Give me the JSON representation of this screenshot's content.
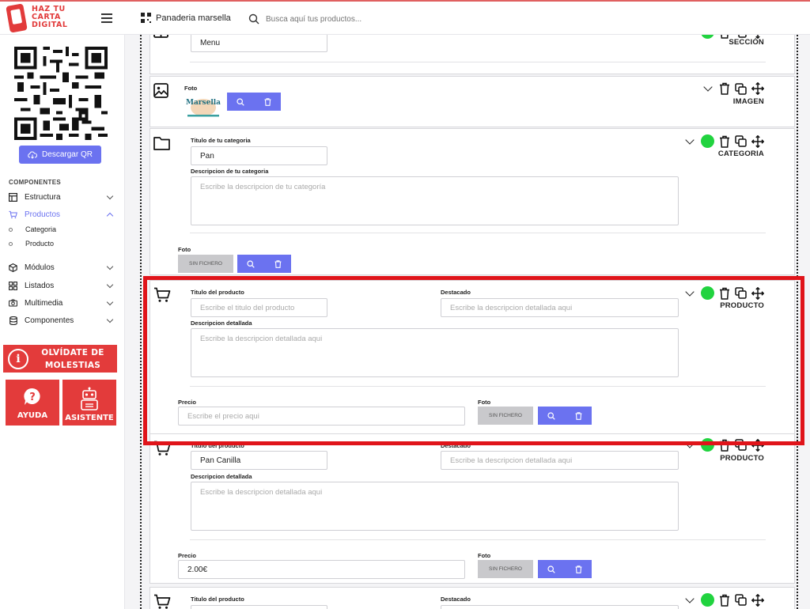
{
  "brand": {
    "logo_text_1": "HAZ TU",
    "logo_text_2": "CARTA",
    "logo_text_3": "DIGITAL"
  },
  "header": {
    "store_name": "Panaderia marsella",
    "search_placeholder": "Busca aquí tus productos..."
  },
  "sidebar": {
    "download_qr": "Descargar QR",
    "section_label": "COMPONENTES",
    "items": [
      {
        "label": "Estructura",
        "icon": "layout-icon"
      },
      {
        "label": "Productos",
        "icon": "cart-icon"
      },
      {
        "label": "Categoria",
        "icon": "circle-icon"
      },
      {
        "label": "Producto",
        "icon": "circle-icon"
      },
      {
        "label": "Módulos",
        "icon": "box-icon"
      },
      {
        "label": "Listados",
        "icon": "grid-icon"
      },
      {
        "label": "Multimedia",
        "icon": "camera-icon"
      },
      {
        "label": "Componentes",
        "icon": "database-icon"
      }
    ],
    "banner_molestias_1": "OLVÍDATE DE",
    "banner_molestias_2": "MOLESTIAS",
    "banner_ayuda": "AYUDA",
    "banner_asistente": "ASISTENTE"
  },
  "cards": {
    "section": {
      "value": "Menu",
      "tag": "SECCIÓN"
    },
    "image": {
      "label": "Foto",
      "logo_text": "Marsella",
      "tag": "IMAGEN"
    },
    "category": {
      "title_label": "Titulo de tu categoria",
      "title_value": "Pan",
      "desc_label": "Descripcion de tu categoria",
      "desc_placeholder": "Escribe la descripcion de tu categoría",
      "photo_label": "Foto",
      "no_file": "SIN FICHERO",
      "tag": "CATEGORIA"
    },
    "product_empty": {
      "title_label": "Titulo del producto",
      "title_placeholder": "Escribe el titulo del producto",
      "featured_label": "Destacado",
      "featured_placeholder": "Escribe la descripcion detallada aqui",
      "desc_label": "Descripcion detallada",
      "desc_placeholder": "Escribe la descripcion detallada aqui",
      "price_label": "Precio",
      "price_placeholder": "Escribe el precio aqui",
      "photo_label": "Foto",
      "no_file": "SIN FICHERO",
      "tag": "PRODUCTO"
    },
    "product_filled": {
      "title_label": "Titulo del producto",
      "title_value": "Pan Canilla",
      "featured_label": "Destacado",
      "featured_placeholder": "Escribe la descripcion detallada aqui",
      "desc_label": "Descripcion detallada",
      "desc_placeholder": "Escribe la descripcion detallada aqui",
      "price_label": "Precio",
      "price_value": "2.00€",
      "photo_label": "Foto",
      "no_file": "SIN FICHERO",
      "tag": "PRODUCTO"
    },
    "product_next": {
      "title_label": "Titulo del producto",
      "featured_label": "Destacado"
    }
  },
  "colors": {
    "accent": "#6b72f0",
    "brand_red": "#e33b3b",
    "active_green": "#21d33f",
    "highlight_red": "#e0141a"
  }
}
